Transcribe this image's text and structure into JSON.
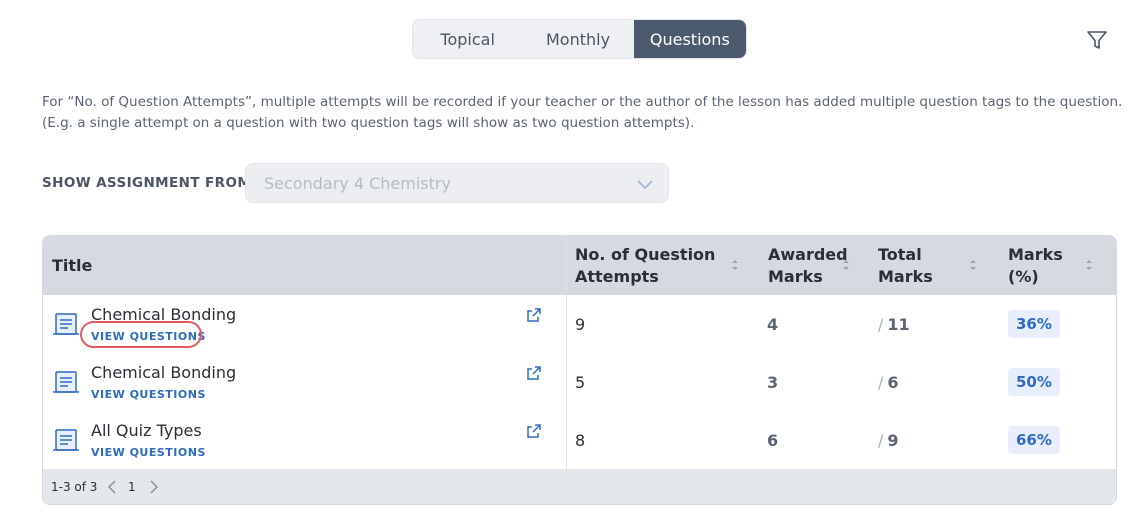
{
  "tabs": [
    {
      "label": "Topical"
    },
    {
      "label": "Monthly"
    },
    {
      "label": "Questions",
      "active": true
    }
  ],
  "info_text": "For “No. of Question Attempts”, multiple attempts will be recorded if your teacher or the author of the lesson has added multiple question tags to the question. (E.g. a single attempt on a question with two question tags will show as two question attempts).",
  "filter": {
    "label": "SHOW ASSIGNMENT FROM",
    "value": "Secondary 4 Chemistry"
  },
  "table": {
    "columns": {
      "title": "Title",
      "attempts": [
        "No. of Question",
        "Attempts"
      ],
      "awarded": [
        "Awarded",
        "Marks"
      ],
      "total": [
        "Total",
        "Marks"
      ],
      "percent": [
        "Marks",
        "(%)"
      ]
    },
    "view_questions_label": "VIEW QUESTIONS",
    "rows": [
      {
        "title": "Chemical Bonding",
        "attempts": "9",
        "awarded": "4",
        "total": "11",
        "percent": "36%"
      },
      {
        "title": "Chemical Bonding",
        "attempts": "5",
        "awarded": "3",
        "total": "6",
        "percent": "50%"
      },
      {
        "title": "All Quiz Types",
        "attempts": "8",
        "awarded": "6",
        "total": "9",
        "percent": "66%"
      }
    ],
    "pagination": {
      "range": "1-3 of 3",
      "page": "1"
    }
  },
  "colors": {
    "active_tab": "#4c5a6e",
    "link": "#2f6bc1",
    "highlight": "#e05a5f"
  }
}
